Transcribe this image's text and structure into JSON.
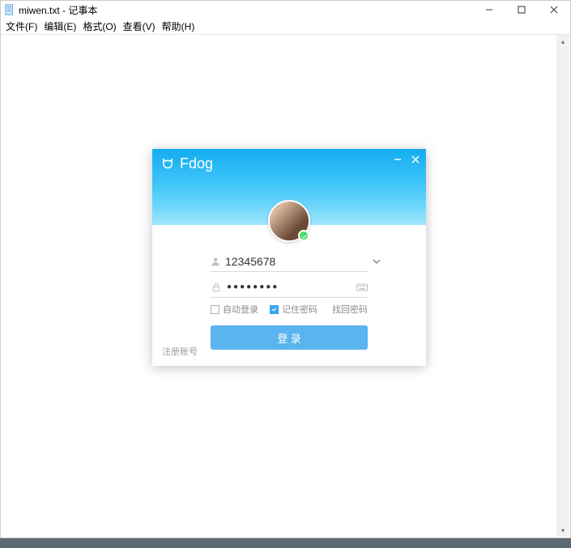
{
  "notepad": {
    "title": "miwen.txt - 记事本",
    "menu": [
      "文件(F)",
      "编辑(E)",
      "格式(O)",
      "查看(V)",
      "帮助(H)"
    ]
  },
  "login": {
    "brand": "Fdog",
    "username": "12345678",
    "password_display": "●●●●●●●●",
    "auto_login_label": "自动登录",
    "remember_label": "记住密码",
    "forgot_label": "找回密码",
    "login_button_label": "登 录",
    "register_label": "注册账号",
    "auto_login_checked": false,
    "remember_checked": true
  }
}
